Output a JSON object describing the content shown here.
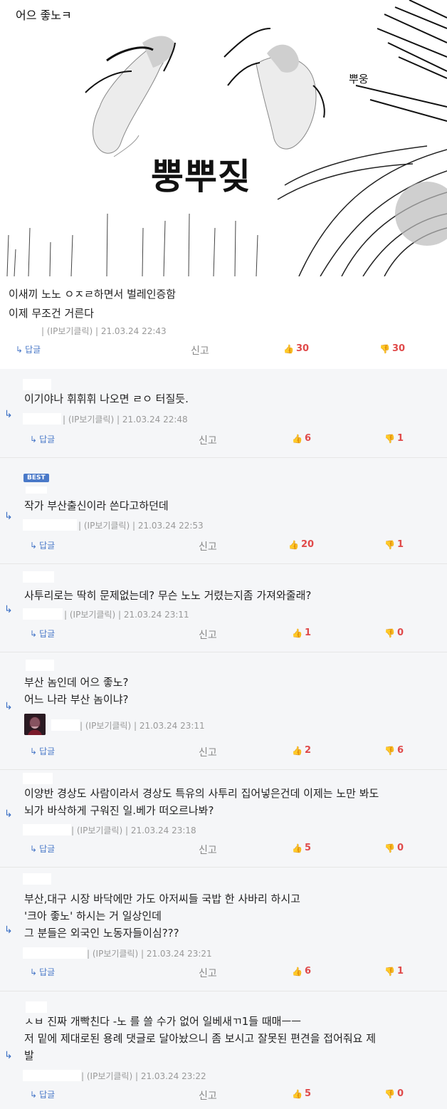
{
  "manga": {
    "sfx_top": "어으 좋노ㅋ",
    "sfx_side": "뿌웅",
    "sfx_big": "뿡뿌짖"
  },
  "post": {
    "text": [
      "이새끼 노노 ㅇㅈㄹ하면서 벌레인증함",
      "이제 무조건 거른다"
    ],
    "meta": "| (IP보기클릭) | 21.03.24 22:43",
    "reply_label": "답글",
    "report_label": "신고",
    "up": "30",
    "down": "30"
  },
  "comments": [
    {
      "best": "",
      "text": "이기야나 휘휘휘 나오면 ㄹㅇ 터질듯.",
      "meta": "| (IP보기클릭) | 21.03.24 22:48",
      "reply_label": "답글",
      "report_label": "신고",
      "up": "6",
      "down": "1"
    },
    {
      "best": "BEST",
      "text": "작가 부산출신이라 쓴다고하던데",
      "meta": "| (IP보기클릭) | 21.03.24 22:53",
      "reply_label": "답글",
      "report_label": "신고",
      "up": "20",
      "down": "1"
    },
    {
      "best": "",
      "text": "사투리로는 딱히 문제없는데? 무슨 노노 거렸는지좀 가져와줄래?",
      "meta": "| (IP보기클릭) | 21.03.24 23:11",
      "reply_label": "답글",
      "report_label": "신고",
      "up": "1",
      "down": "0"
    },
    {
      "best": "",
      "text": "부산 놈인데 어으 좋노?\n어느 나라 부산 놈이냐?",
      "meta": "| (IP보기클릭) | 21.03.24 23:11",
      "reply_label": "답글",
      "report_label": "신고",
      "up": "2",
      "down": "6"
    },
    {
      "best": "",
      "text": "이양반 경상도 사람이라서 경상도 특유의 사투리 집어넣은건데 이제는 노만 봐도\n뇌가 바삭하게 구워진 일.베가 떠오르나봐?",
      "meta": "| (IP보기클릭) | 21.03.24 23:18",
      "reply_label": "답글",
      "report_label": "신고",
      "up": "5",
      "down": "0"
    },
    {
      "best": "",
      "text": "부산,대구 시장 바닥에만 가도 아저씨들 국밥 한 사바리 하시고\n'크아 좋노' 하시는 거 일상인데\n그 분들은 외국인 노동자들이심???",
      "meta": "| (IP보기클릭) | 21.03.24 23:21",
      "reply_label": "답글",
      "report_label": "신고",
      "up": "6",
      "down": "1"
    },
    {
      "best": "",
      "text": "ㅅㅂ 진짜 개빡친다 -노 를 쓸 수가 없어 일베새ㄲ1들 때매ㅡㅡ\n저 밑에 제대로된 용례 댓글로 달아놨으니 좀 보시고 잘못된 편견을 접어줘요 제\n발",
      "meta": "| (IP보기클릭) | 21.03.24 23:22",
      "reply_label": "답글",
      "report_label": "신고",
      "up": "5",
      "down": "0"
    }
  ]
}
